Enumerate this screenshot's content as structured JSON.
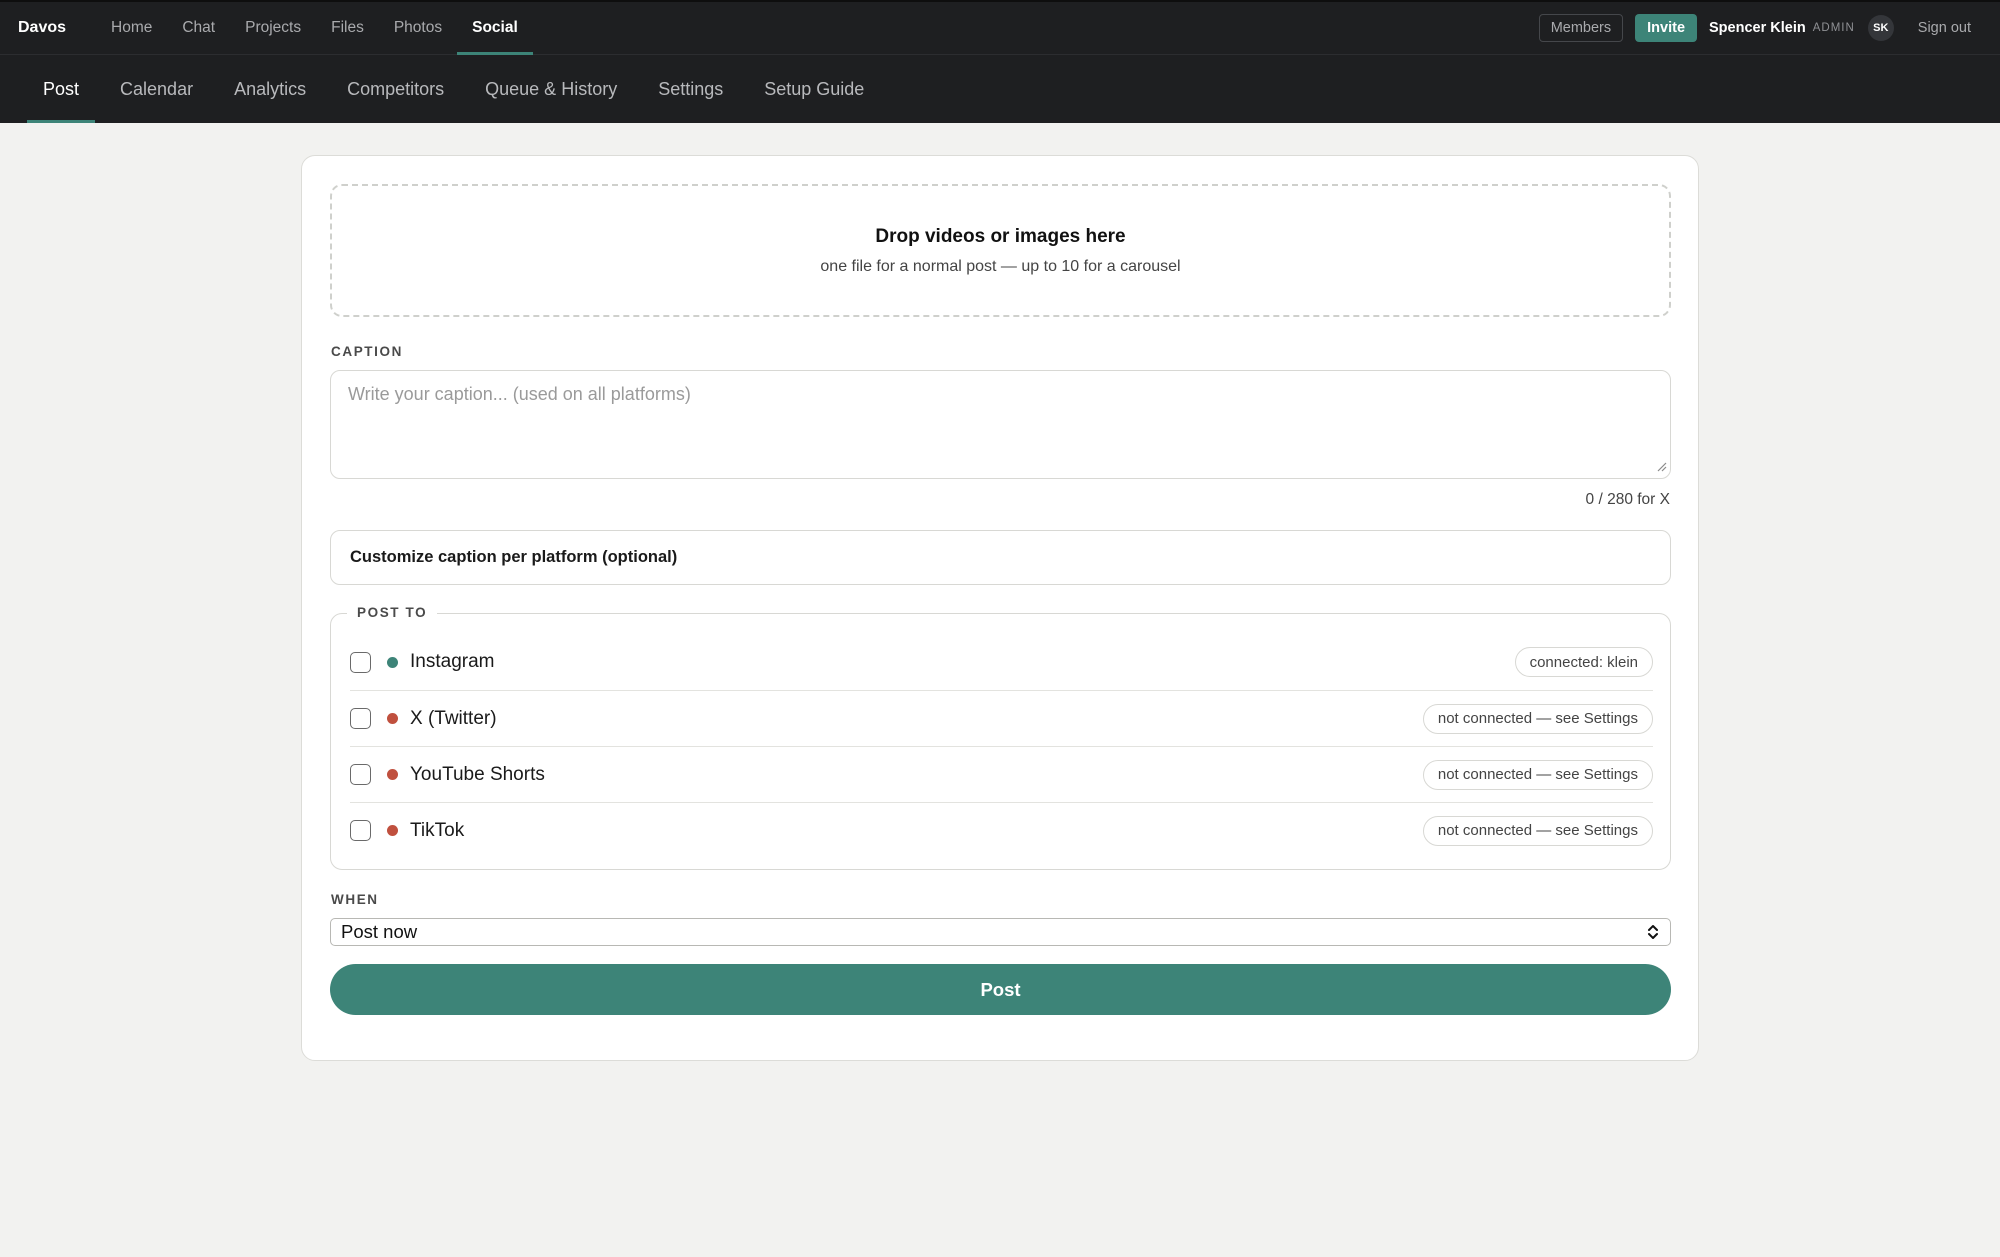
{
  "app": {
    "brand": "Davos"
  },
  "topnav": {
    "items": [
      {
        "label": "Home"
      },
      {
        "label": "Chat"
      },
      {
        "label": "Projects"
      },
      {
        "label": "Files"
      },
      {
        "label": "Photos"
      },
      {
        "label": "Social"
      }
    ],
    "active": "Social"
  },
  "user": {
    "members_label": "Members",
    "invite_label": "Invite",
    "name": "Spencer Klein",
    "role": "ADMIN",
    "initials": "SK",
    "signout_label": "Sign out"
  },
  "subnav": {
    "items": [
      {
        "label": "Post"
      },
      {
        "label": "Calendar"
      },
      {
        "label": "Analytics"
      },
      {
        "label": "Competitors"
      },
      {
        "label": "Queue & History"
      },
      {
        "label": "Settings"
      },
      {
        "label": "Setup Guide"
      }
    ],
    "active": "Post"
  },
  "dropzone": {
    "title": "Drop videos or images here",
    "subtitle": "one file for a normal post — up to 10 for a carousel"
  },
  "caption": {
    "label": "CAPTION",
    "value": "",
    "placeholder": "Write your caption... (used on all platforms)",
    "char_count": "0 / 280 for X"
  },
  "customize": {
    "label": "Customize caption per platform (optional)"
  },
  "post_to": {
    "label": "POST TO",
    "platforms": [
      {
        "name": "Instagram",
        "checked": false,
        "status": "connected: klein",
        "dot_color": "#3d8478"
      },
      {
        "name": "X (Twitter)",
        "checked": false,
        "status": "not connected — see Settings",
        "dot_color": "#c0503e"
      },
      {
        "name": "YouTube Shorts",
        "checked": false,
        "status": "not connected — see Settings",
        "dot_color": "#c0503e"
      },
      {
        "name": "TikTok",
        "checked": false,
        "status": "not connected — see Settings",
        "dot_color": "#c0503e"
      }
    ]
  },
  "when": {
    "label": "WHEN",
    "selected": "Post now"
  },
  "submit": {
    "label": "Post"
  },
  "colors": {
    "accent": "#3d8478",
    "topbar_bg": "#1e1f21",
    "page_bg": "#f2f2f0",
    "disconnected": "#c0503e"
  }
}
